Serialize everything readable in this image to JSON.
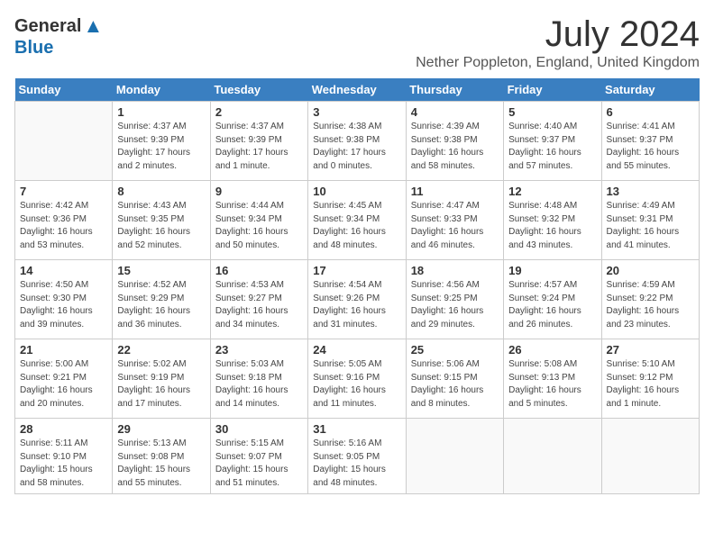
{
  "logo": {
    "general": "General",
    "blue": "Blue"
  },
  "title": "July 2024",
  "subtitle": "Nether Poppleton, England, United Kingdom",
  "days_of_week": [
    "Sunday",
    "Monday",
    "Tuesday",
    "Wednesday",
    "Thursday",
    "Friday",
    "Saturday"
  ],
  "weeks": [
    [
      {
        "day": "",
        "info": ""
      },
      {
        "day": "1",
        "info": "Sunrise: 4:37 AM\nSunset: 9:39 PM\nDaylight: 17 hours\nand 2 minutes."
      },
      {
        "day": "2",
        "info": "Sunrise: 4:37 AM\nSunset: 9:39 PM\nDaylight: 17 hours\nand 1 minute."
      },
      {
        "day": "3",
        "info": "Sunrise: 4:38 AM\nSunset: 9:38 PM\nDaylight: 17 hours\nand 0 minutes."
      },
      {
        "day": "4",
        "info": "Sunrise: 4:39 AM\nSunset: 9:38 PM\nDaylight: 16 hours\nand 58 minutes."
      },
      {
        "day": "5",
        "info": "Sunrise: 4:40 AM\nSunset: 9:37 PM\nDaylight: 16 hours\nand 57 minutes."
      },
      {
        "day": "6",
        "info": "Sunrise: 4:41 AM\nSunset: 9:37 PM\nDaylight: 16 hours\nand 55 minutes."
      }
    ],
    [
      {
        "day": "7",
        "info": "Sunrise: 4:42 AM\nSunset: 9:36 PM\nDaylight: 16 hours\nand 53 minutes."
      },
      {
        "day": "8",
        "info": "Sunrise: 4:43 AM\nSunset: 9:35 PM\nDaylight: 16 hours\nand 52 minutes."
      },
      {
        "day": "9",
        "info": "Sunrise: 4:44 AM\nSunset: 9:34 PM\nDaylight: 16 hours\nand 50 minutes."
      },
      {
        "day": "10",
        "info": "Sunrise: 4:45 AM\nSunset: 9:34 PM\nDaylight: 16 hours\nand 48 minutes."
      },
      {
        "day": "11",
        "info": "Sunrise: 4:47 AM\nSunset: 9:33 PM\nDaylight: 16 hours\nand 46 minutes."
      },
      {
        "day": "12",
        "info": "Sunrise: 4:48 AM\nSunset: 9:32 PM\nDaylight: 16 hours\nand 43 minutes."
      },
      {
        "day": "13",
        "info": "Sunrise: 4:49 AM\nSunset: 9:31 PM\nDaylight: 16 hours\nand 41 minutes."
      }
    ],
    [
      {
        "day": "14",
        "info": "Sunrise: 4:50 AM\nSunset: 9:30 PM\nDaylight: 16 hours\nand 39 minutes."
      },
      {
        "day": "15",
        "info": "Sunrise: 4:52 AM\nSunset: 9:29 PM\nDaylight: 16 hours\nand 36 minutes."
      },
      {
        "day": "16",
        "info": "Sunrise: 4:53 AM\nSunset: 9:27 PM\nDaylight: 16 hours\nand 34 minutes."
      },
      {
        "day": "17",
        "info": "Sunrise: 4:54 AM\nSunset: 9:26 PM\nDaylight: 16 hours\nand 31 minutes."
      },
      {
        "day": "18",
        "info": "Sunrise: 4:56 AM\nSunset: 9:25 PM\nDaylight: 16 hours\nand 29 minutes."
      },
      {
        "day": "19",
        "info": "Sunrise: 4:57 AM\nSunset: 9:24 PM\nDaylight: 16 hours\nand 26 minutes."
      },
      {
        "day": "20",
        "info": "Sunrise: 4:59 AM\nSunset: 9:22 PM\nDaylight: 16 hours\nand 23 minutes."
      }
    ],
    [
      {
        "day": "21",
        "info": "Sunrise: 5:00 AM\nSunset: 9:21 PM\nDaylight: 16 hours\nand 20 minutes."
      },
      {
        "day": "22",
        "info": "Sunrise: 5:02 AM\nSunset: 9:19 PM\nDaylight: 16 hours\nand 17 minutes."
      },
      {
        "day": "23",
        "info": "Sunrise: 5:03 AM\nSunset: 9:18 PM\nDaylight: 16 hours\nand 14 minutes."
      },
      {
        "day": "24",
        "info": "Sunrise: 5:05 AM\nSunset: 9:16 PM\nDaylight: 16 hours\nand 11 minutes."
      },
      {
        "day": "25",
        "info": "Sunrise: 5:06 AM\nSunset: 9:15 PM\nDaylight: 16 hours\nand 8 minutes."
      },
      {
        "day": "26",
        "info": "Sunrise: 5:08 AM\nSunset: 9:13 PM\nDaylight: 16 hours\nand 5 minutes."
      },
      {
        "day": "27",
        "info": "Sunrise: 5:10 AM\nSunset: 9:12 PM\nDaylight: 16 hours\nand 1 minute."
      }
    ],
    [
      {
        "day": "28",
        "info": "Sunrise: 5:11 AM\nSunset: 9:10 PM\nDaylight: 15 hours\nand 58 minutes."
      },
      {
        "day": "29",
        "info": "Sunrise: 5:13 AM\nSunset: 9:08 PM\nDaylight: 15 hours\nand 55 minutes."
      },
      {
        "day": "30",
        "info": "Sunrise: 5:15 AM\nSunset: 9:07 PM\nDaylight: 15 hours\nand 51 minutes."
      },
      {
        "day": "31",
        "info": "Sunrise: 5:16 AM\nSunset: 9:05 PM\nDaylight: 15 hours\nand 48 minutes."
      },
      {
        "day": "",
        "info": ""
      },
      {
        "day": "",
        "info": ""
      },
      {
        "day": "",
        "info": ""
      }
    ]
  ]
}
